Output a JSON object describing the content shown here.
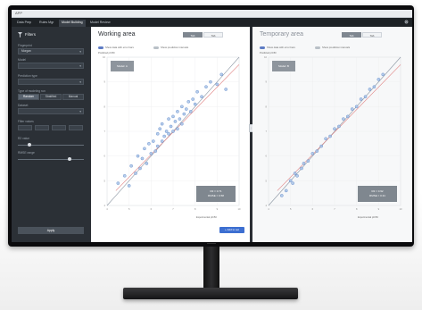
{
  "window": {
    "title": "APP"
  },
  "tabs": [
    {
      "label": "Data Prep",
      "active": false
    },
    {
      "label": "Rules Mgr",
      "active": false
    },
    {
      "label": "Model Building",
      "active": true
    },
    {
      "label": "Model Review",
      "active": false
    }
  ],
  "sidebar": {
    "title": "Filters",
    "fields": [
      {
        "label": "Fingerprint",
        "value": "Morgan"
      },
      {
        "label": "Model",
        "value": ""
      },
      {
        "label": "Prediction type",
        "value": ""
      },
      {
        "label": "Type of modeling run",
        "segments": [
          "Random",
          "Stratified",
          "Manual"
        ],
        "selected": 0
      },
      {
        "label": "Dataset",
        "value": ""
      },
      {
        "label": "Filter values",
        "inputs": [
          "",
          "",
          "",
          ""
        ]
      },
      {
        "label": "R2 value",
        "slider": 0.15
      },
      {
        "label": "RMSE range",
        "slider": 0.8
      }
    ],
    "button_label": "Apply"
  },
  "working": {
    "title": "Working area",
    "toggle": [
      "Tab",
      "Tab"
    ],
    "checkbox_on": "Show data with error bars",
    "checkbox_off": "Show prediction intervals",
    "y_axis_title": "Predicted pIC50",
    "x_axis_title": "Experimental pIC50",
    "badge": "Model: A",
    "stats": [
      "R2 = 0.71",
      "RMSE = 0.58"
    ],
    "add_label": "+ Add to set"
  },
  "temporary": {
    "title": "Temporary area",
    "toggle": [
      "Tab",
      "Tab"
    ],
    "checkbox_on": "Show data with error bars",
    "checkbox_off": "Show prediction intervals",
    "y_axis_title": "Predicted pIC50",
    "x_axis_title": "Experimental pIC50",
    "badge": "Model: B",
    "stats": [
      "R2 = 0.92",
      "RMSE = 0.31"
    ]
  },
  "colors": {
    "accent": "#3d6fd1",
    "point_fill": "#a9c4e8",
    "point_stroke": "#5b84c6",
    "fit_line": "#e08080",
    "identity_line": "#8c96a3"
  },
  "chart_data": [
    {
      "type": "scatter",
      "title": "Working area",
      "xlabel": "Experimental pIC50",
      "ylabel": "Predicted pIC50",
      "xlim": [
        4,
        10
      ],
      "ylim": [
        4,
        10
      ],
      "grid": true,
      "x": [
        4.5,
        4.8,
        5.0,
        5.1,
        5.3,
        5.4,
        5.5,
        5.6,
        5.7,
        5.8,
        5.9,
        6.0,
        6.1,
        6.2,
        6.3,
        6.3,
        6.4,
        6.5,
        6.5,
        6.6,
        6.7,
        6.8,
        6.8,
        6.9,
        7.0,
        7.0,
        7.1,
        7.2,
        7.2,
        7.3,
        7.4,
        7.4,
        7.5,
        7.6,
        7.7,
        7.8,
        7.9,
        8.0,
        8.1,
        8.3,
        8.5,
        8.7,
        9.0,
        9.2,
        9.4
      ],
      "y": [
        4.9,
        5.2,
        4.8,
        5.6,
        5.3,
        6.0,
        5.5,
        5.9,
        6.3,
        5.7,
        6.5,
        6.1,
        6.6,
        6.2,
        6.9,
        6.4,
        7.1,
        6.6,
        7.3,
        6.8,
        7.0,
        7.5,
        6.9,
        7.2,
        7.6,
        7.0,
        7.4,
        7.8,
        7.1,
        7.5,
        8.0,
        7.3,
        7.7,
        7.9,
        8.2,
        7.8,
        8.3,
        8.1,
        8.6,
        8.4,
        8.8,
        9.0,
        8.9,
        9.3,
        8.7
      ]
    },
    {
      "type": "scatter",
      "title": "Temporary area",
      "xlabel": "Experimental pIC50",
      "ylabel": "Predicted pIC50",
      "xlim": [
        4,
        10
      ],
      "ylim": [
        4,
        10
      ],
      "grid": true,
      "x": [
        4.6,
        4.8,
        5.0,
        5.1,
        5.2,
        5.3,
        5.5,
        5.6,
        5.8,
        6.0,
        6.2,
        6.4,
        6.6,
        6.8,
        7.0,
        7.2,
        7.4,
        7.6,
        7.8,
        8.0,
        8.2,
        8.4,
        8.6,
        8.8,
        9.0,
        9.2
      ],
      "y": [
        4.4,
        4.6,
        5.0,
        4.9,
        5.3,
        5.2,
        5.5,
        5.7,
        5.8,
        6.1,
        6.2,
        6.4,
        6.7,
        6.8,
        7.1,
        7.2,
        7.5,
        7.6,
        7.9,
        8.0,
        8.3,
        8.4,
        8.7,
        8.8,
        9.1,
        9.3
      ]
    }
  ]
}
